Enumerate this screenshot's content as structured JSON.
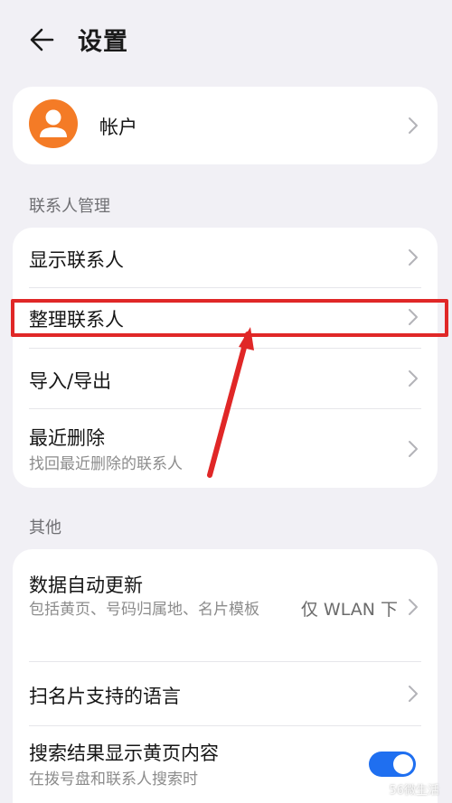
{
  "header": {
    "title": "设置"
  },
  "account": {
    "label": "帐户"
  },
  "sections": {
    "contacts": {
      "label": "联系人管理"
    },
    "other": {
      "label": "其他"
    }
  },
  "contacts_rows": {
    "show": {
      "title": "显示联系人"
    },
    "organize": {
      "title": "整理联系人"
    },
    "import_export": {
      "title": "导入/导出"
    },
    "recently_deleted": {
      "title": "最近删除",
      "subtitle": "找回最近删除的联系人"
    }
  },
  "other_rows": {
    "auto_update": {
      "title": "数据自动更新",
      "subtitle": "包括黄页、号码归属地、名片模板",
      "value": "仅 WLAN 下"
    },
    "card_lang": {
      "title": "扫名片支持的语言"
    },
    "search_yellow": {
      "title": "搜索结果显示黄页内容",
      "subtitle": "在拨号盘和联系人搜索时",
      "toggle_on": true
    }
  },
  "watermark": {
    "text": "56微生活"
  },
  "colors": {
    "accent": "#1f6ff0",
    "avatar": "#f47b26",
    "highlight": "#e02727"
  },
  "icons": [
    "back-arrow-icon",
    "avatar-person-icon",
    "chevron-right-icon"
  ]
}
